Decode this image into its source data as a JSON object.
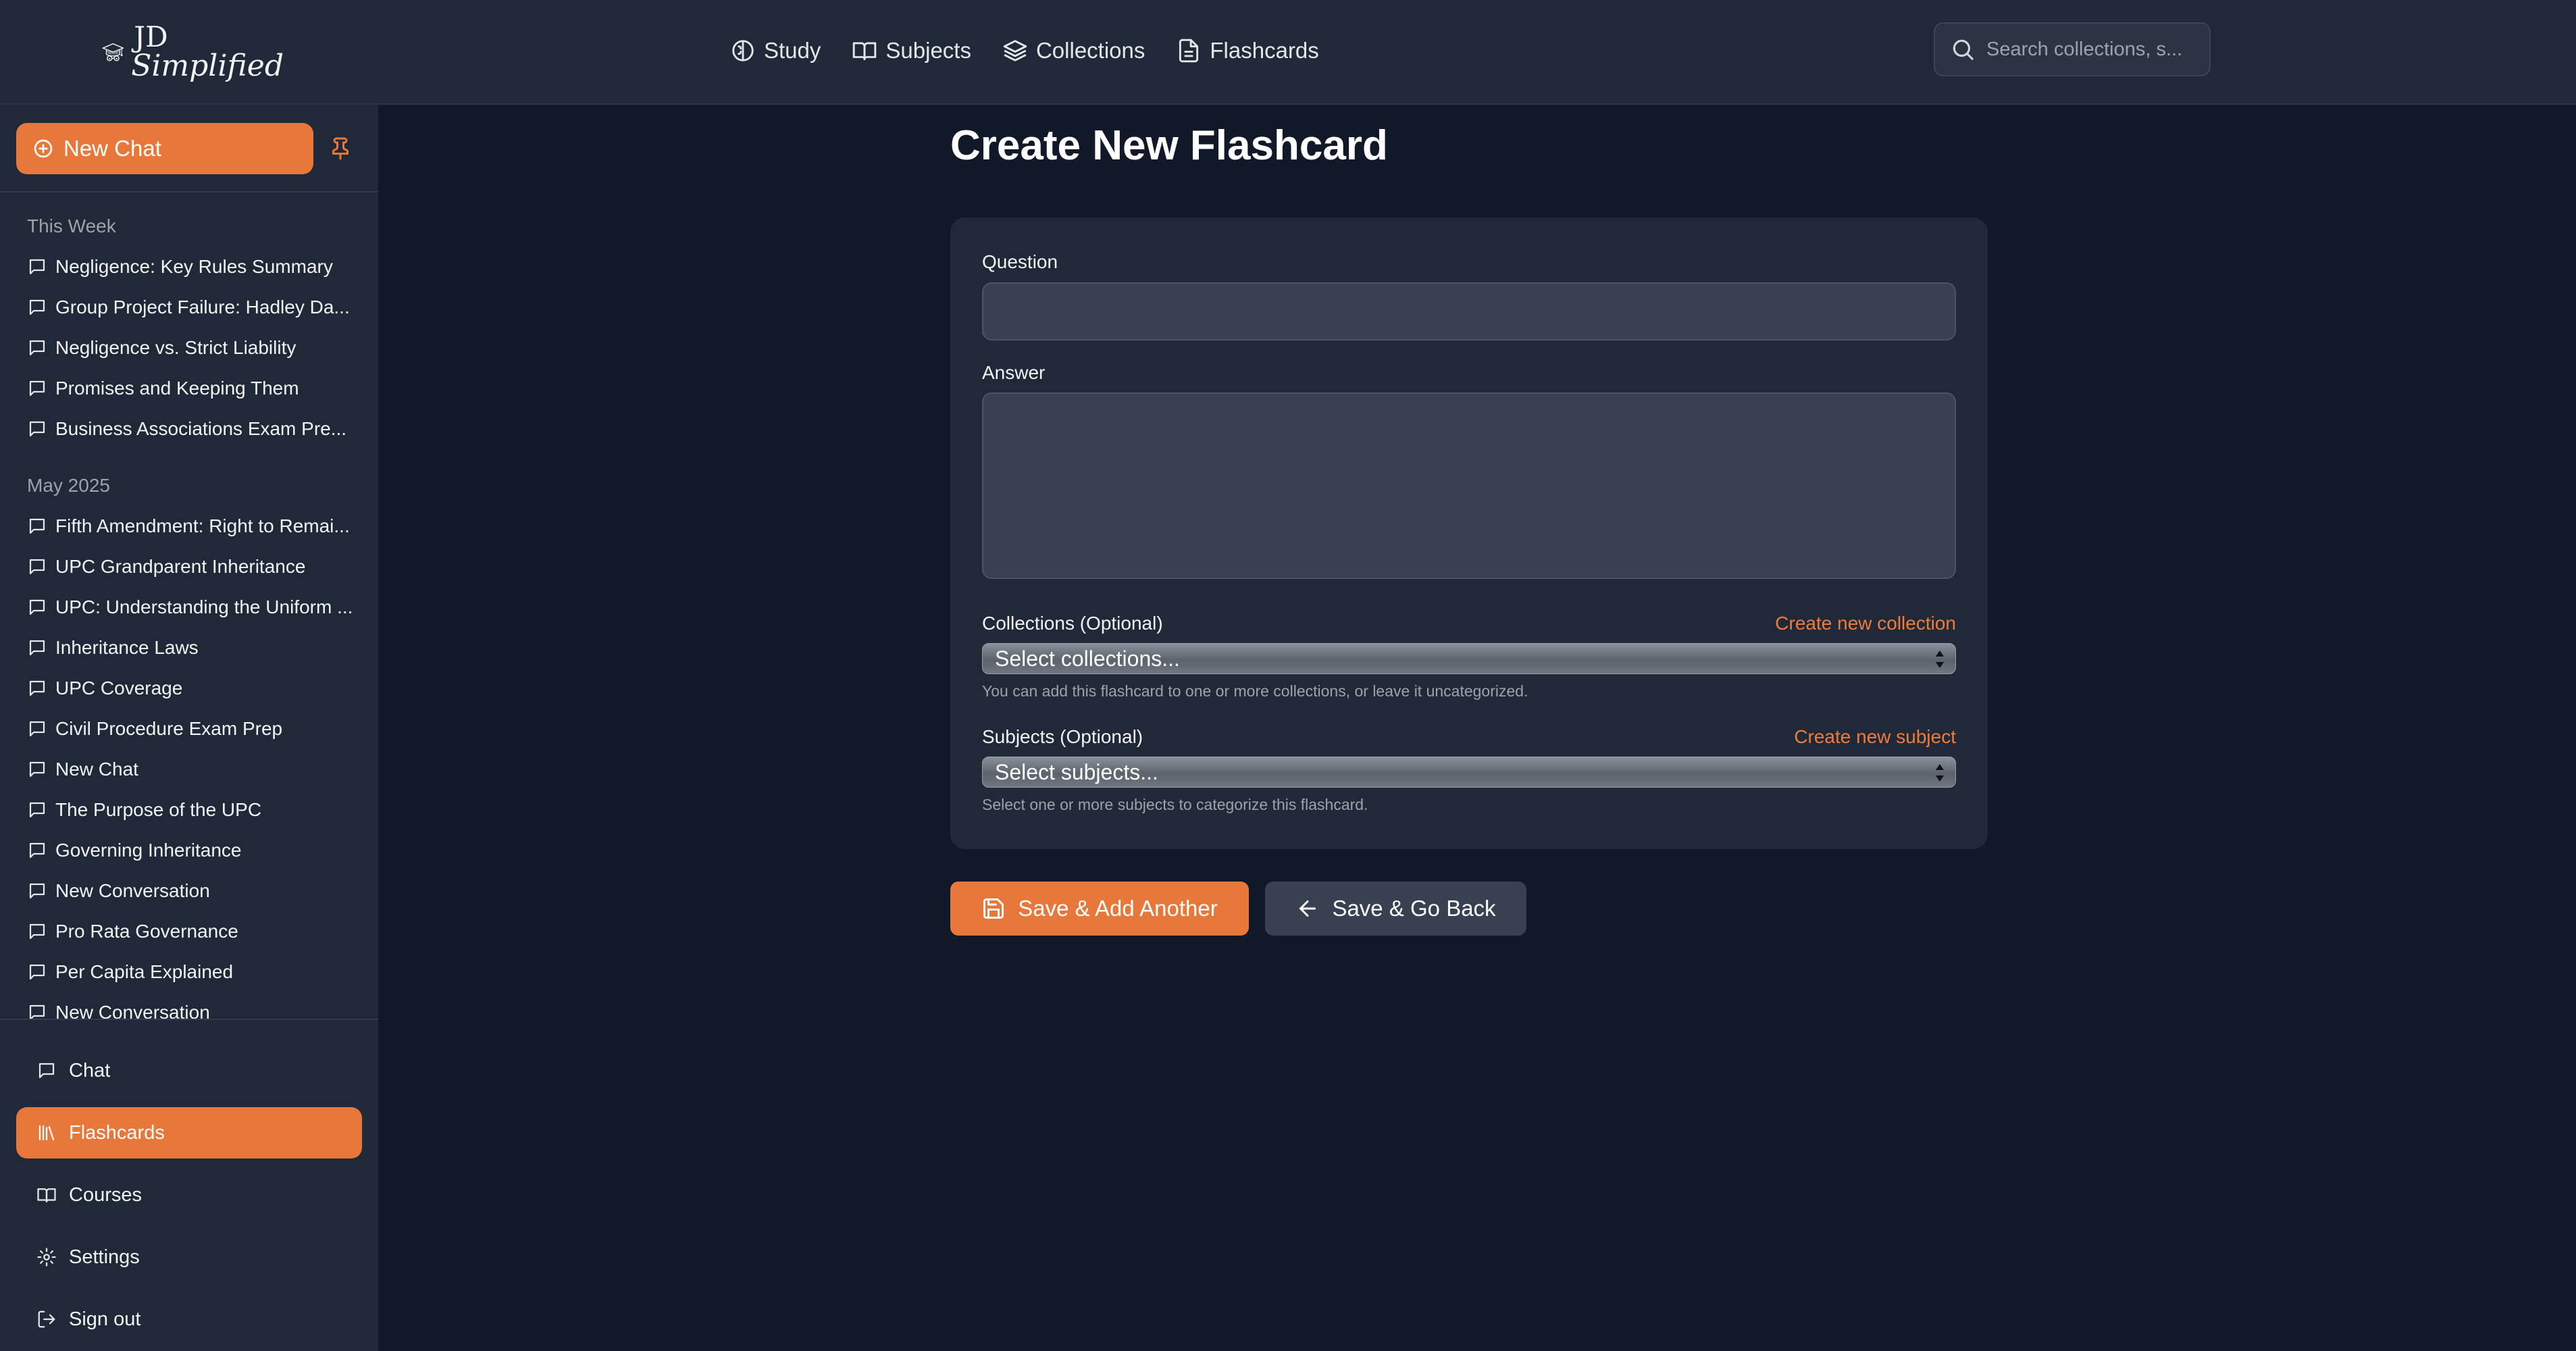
{
  "brand": {
    "line1": "JD",
    "line2": "Simplified"
  },
  "topnav": [
    {
      "label": "Study",
      "icon": "brain-icon"
    },
    {
      "label": "Subjects",
      "icon": "book-open-icon"
    },
    {
      "label": "Collections",
      "icon": "layers-icon"
    },
    {
      "label": "Flashcards",
      "icon": "file-text-icon"
    }
  ],
  "search": {
    "placeholder": "Search collections, s..."
  },
  "sidebar": {
    "new_chat_label": "New Chat",
    "groups": [
      {
        "label": "This Week",
        "items": [
          "Negligence: Key Rules Summary",
          "Group Project Failure: Hadley Da...",
          "Negligence vs. Strict Liability",
          "Promises and Keeping Them",
          "Business Associations Exam Pre..."
        ]
      },
      {
        "label": "May 2025",
        "items": [
          "Fifth Amendment: Right to Remai...",
          "UPC Grandparent Inheritance",
          "UPC: Understanding the Uniform ...",
          "Inheritance Laws",
          "UPC Coverage",
          "Civil Procedure Exam Prep",
          "New Chat",
          "The Purpose of the UPC",
          "Governing Inheritance",
          "New Conversation",
          "Pro Rata Governance",
          "Per Capita Explained",
          "New Conversation"
        ]
      }
    ],
    "bottom_nav": [
      {
        "label": "Chat",
        "icon": "message-icon",
        "active": false
      },
      {
        "label": "Flashcards",
        "icon": "library-icon",
        "active": true
      },
      {
        "label": "Courses",
        "icon": "book-icon",
        "active": false
      },
      {
        "label": "Settings",
        "icon": "gear-icon",
        "active": false
      },
      {
        "label": "Sign out",
        "icon": "logout-icon",
        "active": false
      }
    ]
  },
  "main": {
    "title": "Create New Flashcard",
    "question_label": "Question",
    "question_value": "",
    "answer_label": "Answer",
    "answer_value": "",
    "collections_label": "Collections (Optional)",
    "create_collection_link": "Create new collection",
    "collections_select": "Select collections...",
    "collections_hint": "You can add this flashcard to one or more collections, or leave it uncategorized.",
    "subjects_label": "Subjects (Optional)",
    "create_subject_link": "Create new subject",
    "subjects_select": "Select subjects...",
    "subjects_hint": "Select one or more subjects to categorize this flashcard.",
    "save_add_label": "Save & Add Another",
    "save_back_label": "Save & Go Back"
  },
  "colors": {
    "accent": "#e8773a",
    "background": "#111827",
    "panel": "#1f2937"
  }
}
